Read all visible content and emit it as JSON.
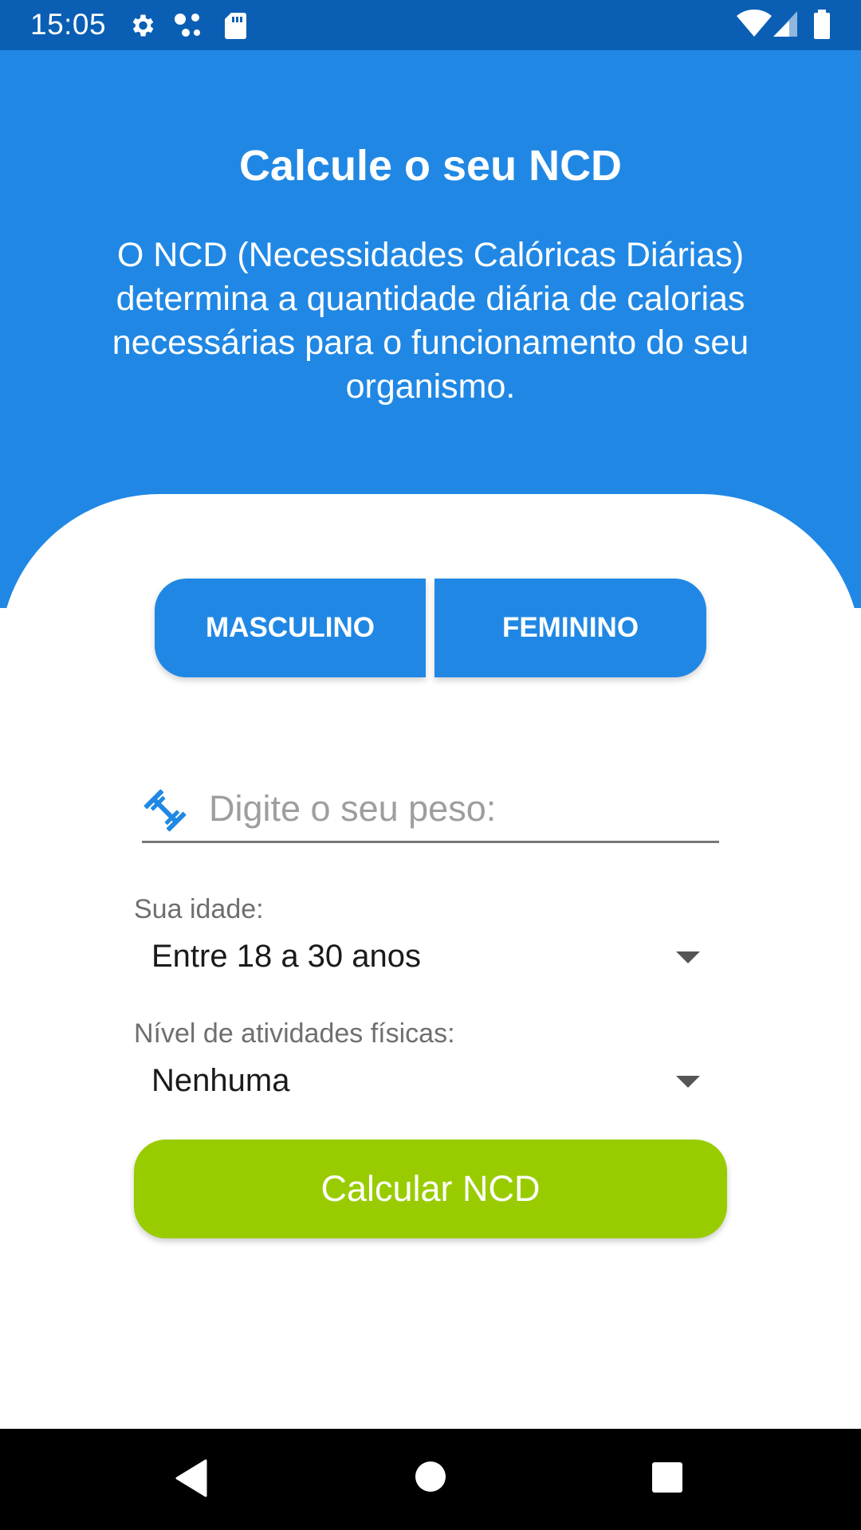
{
  "status_bar": {
    "time": "15:05",
    "icons_left": [
      "gear-icon",
      "dots-icon",
      "sd-card-icon"
    ],
    "icons_right": [
      "wifi-icon",
      "signal-icon",
      "battery-icon"
    ]
  },
  "header": {
    "title": "Calcule o seu NCD",
    "description": "O NCD (Necessidades Calóricas Diárias) determina a quantidade diária de calorias necessárias para o funcionamento do seu organismo."
  },
  "gender": {
    "male_label": "MASCULINO",
    "female_label": "FEMININO"
  },
  "weight": {
    "icon": "dumbbell-icon",
    "placeholder": "Digite o seu peso:",
    "value": ""
  },
  "age": {
    "label": "Sua idade:",
    "selected": "Entre 18 a 30 anos"
  },
  "activity": {
    "label": "Nível de atividades físicas:",
    "selected": "Nenhuma"
  },
  "calculate_button": "Calcular NCD",
  "nav": {
    "back": "back-icon",
    "home": "home-icon",
    "recents": "recents-icon"
  },
  "colors": {
    "status_bar": "#0a5fb4",
    "primary": "#2088e4",
    "accent": "#99cc00"
  }
}
